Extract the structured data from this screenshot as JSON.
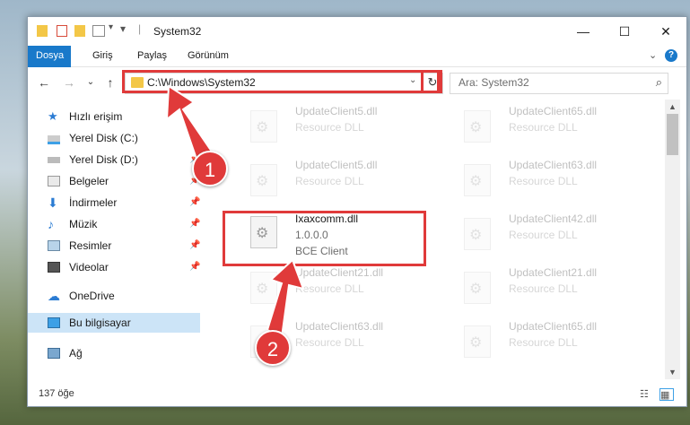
{
  "window": {
    "title": "System32",
    "controls": {
      "minimize": "—",
      "maximize": "☐",
      "close": "✕"
    }
  },
  "quick_access": {
    "dropdown": "▾",
    "separator": "|"
  },
  "ribbon": {
    "tabs": [
      {
        "label": "Dosya",
        "active": true
      },
      {
        "label": "Giriş"
      },
      {
        "label": "Paylaş"
      },
      {
        "label": "Görünüm"
      }
    ],
    "expand": "⌄",
    "help": "?"
  },
  "nav": {
    "back": "←",
    "forward": "→",
    "recent": "⌄",
    "up": "↑",
    "address": "C:\\Windows\\System32",
    "address_dropdown": "⌄",
    "refresh": "↻",
    "search_placeholder": "Ara: System32"
  },
  "nav_pane": [
    {
      "label": "Hızlı erişim",
      "icon": "star-icon",
      "color": "#2b7cd3"
    },
    {
      "label": "Yerel Disk (C:)",
      "icon": "drive-icon",
      "pinned": true
    },
    {
      "label": "Yerel Disk (D:)",
      "icon": "drive-icon",
      "pinned": true
    },
    {
      "label": "Belgeler",
      "icon": "documents-icon",
      "pinned": true
    },
    {
      "label": "İndirmeler",
      "icon": "downloads-icon",
      "pinned": true
    },
    {
      "label": "Müzik",
      "icon": "music-icon",
      "pinned": true
    },
    {
      "label": "Resimler",
      "icon": "pictures-icon",
      "pinned": true
    },
    {
      "label": "Videolar",
      "icon": "videos-icon",
      "pinned": true
    },
    {
      "label": "OneDrive",
      "icon": "cloud-icon"
    },
    {
      "label": "Bu bilgisayar",
      "icon": "computer-icon",
      "selected": true
    },
    {
      "label": "Ağ",
      "icon": "network-icon"
    }
  ],
  "pin_glyph": "📌",
  "files": [
    {
      "name": "UpdateClient5.dll",
      "sub": "Resource DLL",
      "faded": true
    },
    {
      "name": "UpdateClient65.dll",
      "sub": "Resource DLL",
      "faded": true
    },
    {
      "name": "UpdateClient5.dll",
      "sub": "Resource DLL",
      "faded": true
    },
    {
      "name": "UpdateClient63.dll",
      "sub": "Resource DLL",
      "faded": true
    },
    {
      "name": "Ixaxcomm.dll",
      "sub": "1.0.0.0",
      "sub2": "BCE Client",
      "faded": false
    },
    {
      "name": "UpdateClient42.dll",
      "sub": "Resource DLL",
      "faded": true
    },
    {
      "name": "UpdateClient21.dll",
      "sub": "Resource DLL",
      "faded": true
    },
    {
      "name": "UpdateClient21.dll",
      "sub": "Resource DLL",
      "faded": true
    },
    {
      "name": "UpdateClient63.dll",
      "sub": "Resource DLL",
      "faded": true
    },
    {
      "name": "UpdateClient65.dll",
      "sub": "Resource DLL",
      "faded": true
    }
  ],
  "status": {
    "count": "137 öğe"
  },
  "annotations": {
    "step1": "1",
    "step2": "2",
    "highlight_color": "#e03a3a"
  }
}
